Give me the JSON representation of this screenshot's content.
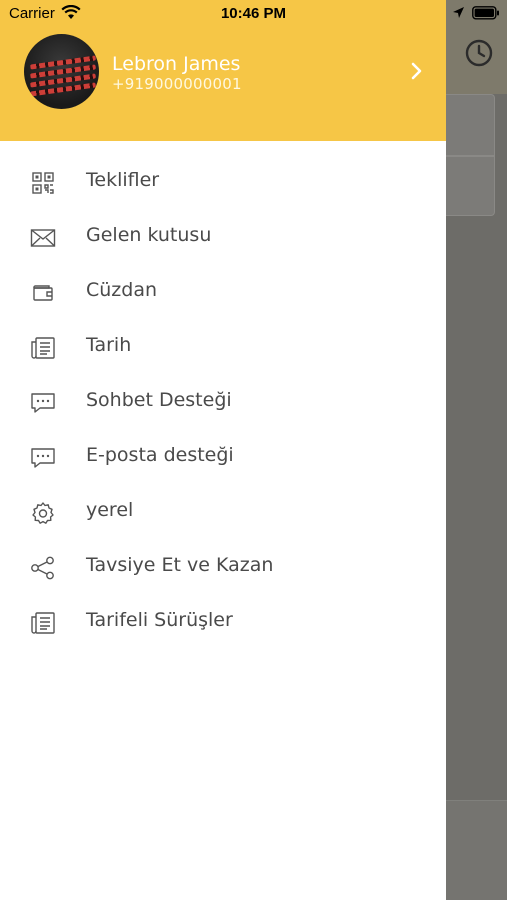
{
  "status_bar": {
    "carrier": "Carrier",
    "time": "10:46 PM"
  },
  "user": {
    "name": "Lebron James",
    "phone": "+919000000001"
  },
  "menu": [
    {
      "label": "Teklifler",
      "icon": "qr-code-icon"
    },
    {
      "label": "Gelen kutusu",
      "icon": "envelope-icon"
    },
    {
      "label": "Cüzdan",
      "icon": "wallet-icon"
    },
    {
      "label": "Tarih",
      "icon": "history-list-icon"
    },
    {
      "label": "Sohbet Desteği",
      "icon": "chat-bubble-icon"
    },
    {
      "label": "E-posta desteği",
      "icon": "chat-bubble-icon"
    },
    {
      "label": "yerel",
      "icon": "gear-icon"
    },
    {
      "label": "Tavsiye Et ve Kazan",
      "icon": "share-icon"
    },
    {
      "label": "Tarifeli Sürüşler",
      "icon": "history-list-icon"
    }
  ],
  "colors": {
    "header_yellow": "#f6c646",
    "menu_text": "#4a4a4a",
    "overlay": "#6d6c68"
  }
}
